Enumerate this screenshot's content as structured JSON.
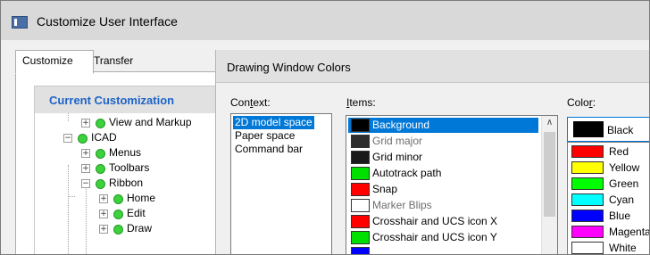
{
  "window": {
    "title": "Customize User Interface"
  },
  "tabs": [
    {
      "label": "Customize",
      "active": true
    },
    {
      "label": "Transfer",
      "active": false
    }
  ],
  "left_panel": {
    "title": "Current Customization",
    "tree": [
      {
        "label": "View and Markup",
        "expander": "+"
      },
      {
        "label": "ICAD",
        "expander": "−"
      },
      {
        "label": "Menus",
        "expander": "+"
      },
      {
        "label": "Toolbars",
        "expander": "+"
      },
      {
        "label": "Ribbon",
        "expander": "−"
      },
      {
        "label": "Home",
        "expander": "+"
      },
      {
        "label": "Edit",
        "expander": "+"
      },
      {
        "label": "Draw",
        "expander": "+"
      }
    ]
  },
  "dwc": {
    "title": "Drawing Window Colors",
    "context_label_pre": "Con",
    "context_label_u": "t",
    "context_label_post": "ext:",
    "items_label_u": "I",
    "items_label_post": "tems:",
    "color_label_pre": "Colo",
    "color_label_u": "r",
    "color_label_post": ":",
    "context_items": [
      {
        "label": "2D model space",
        "selected": true
      },
      {
        "label": "Paper space",
        "selected": false
      },
      {
        "label": "Command bar",
        "selected": false
      }
    ],
    "items": [
      {
        "label": "Background",
        "color": "#000000",
        "selected": true,
        "dim": false
      },
      {
        "label": "Grid major",
        "color": "#2e2e2e",
        "selected": false,
        "dim": true
      },
      {
        "label": "Grid minor",
        "color": "#1a1a1a",
        "selected": false,
        "dim": false
      },
      {
        "label": "Autotrack path",
        "color": "#00e000",
        "selected": false,
        "dim": false
      },
      {
        "label": "Snap",
        "color": "#ff0000",
        "selected": false,
        "dim": false
      },
      {
        "label": "Marker Blips",
        "color": "#ffffff",
        "selected": false,
        "dim": true
      },
      {
        "label": "Crosshair and UCS icon X",
        "color": "#ff0000",
        "selected": false,
        "dim": false
      },
      {
        "label": "Crosshair and UCS icon Y",
        "color": "#00e000",
        "selected": false,
        "dim": false
      },
      {
        "label": "",
        "color": "#0000ff",
        "selected": false,
        "dim": false
      }
    ],
    "current_color": {
      "label": "Black",
      "color": "#000000"
    },
    "colors": [
      {
        "label": "Red",
        "color": "#ff0000"
      },
      {
        "label": "Yellow",
        "color": "#ffff00"
      },
      {
        "label": "Green",
        "color": "#00ff00"
      },
      {
        "label": "Cyan",
        "color": "#00ffff"
      },
      {
        "label": "Blue",
        "color": "#0000ff"
      },
      {
        "label": "Magenta",
        "color": "#ff00ff"
      },
      {
        "label": "White",
        "color": "#ffffff"
      }
    ]
  }
}
